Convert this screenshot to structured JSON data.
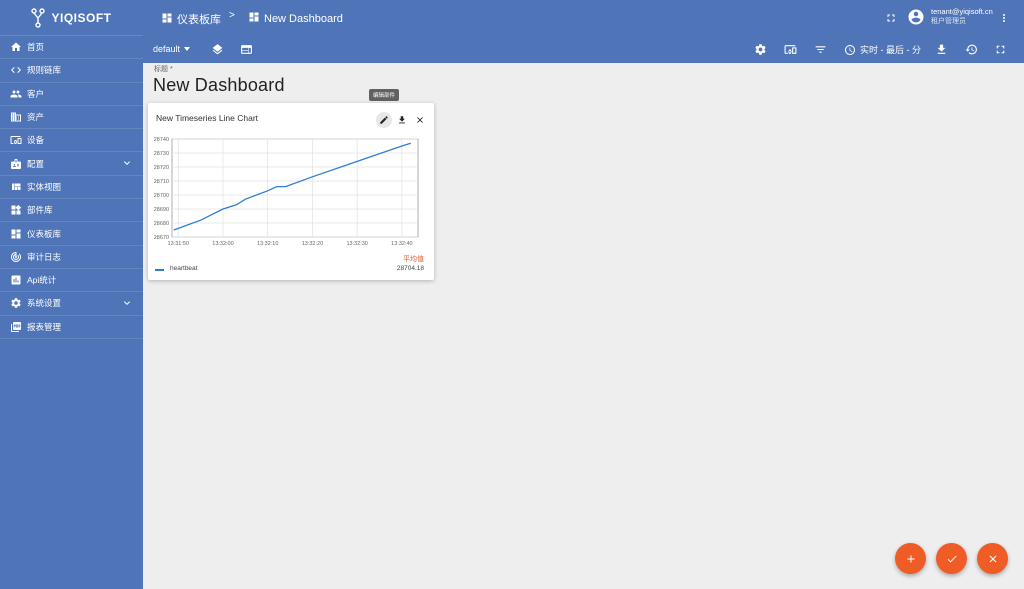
{
  "app": {
    "logo_text": "YIQISOFT"
  },
  "sidebar": {
    "items": [
      {
        "label": "首页",
        "icon": "home-icon"
      },
      {
        "label": "规则链库",
        "icon": "code-icon"
      },
      {
        "label": "客户",
        "icon": "people-icon"
      },
      {
        "label": "资产",
        "icon": "domain-icon"
      },
      {
        "label": "设备",
        "icon": "devices-icon"
      },
      {
        "label": "配置",
        "icon": "badge-icon",
        "expandable": true
      },
      {
        "label": "实体视图",
        "icon": "view-quilt-icon"
      },
      {
        "label": "部件库",
        "icon": "widgets-icon"
      },
      {
        "label": "仪表板库",
        "icon": "dashboard-icon"
      },
      {
        "label": "审计日志",
        "icon": "track-changes-icon"
      },
      {
        "label": "Api统计",
        "icon": "insert-chart-icon"
      },
      {
        "label": "系统设置",
        "icon": "settings-icon",
        "expandable": true
      },
      {
        "label": "报表管理",
        "icon": "pdf-icon"
      }
    ]
  },
  "header": {
    "breadcrumb": [
      {
        "label": "仪表板库",
        "icon": "dashboard-icon"
      },
      {
        "label": "New Dashboard",
        "icon": "dashboard-icon"
      }
    ],
    "separator": ">",
    "user_email": "tenant@yiqisoft.cn",
    "user_role": "租户管理员"
  },
  "toolbar": {
    "state_selector": "default",
    "timewindow": "实时 - 最后 - 分"
  },
  "main": {
    "title_label": "标题 *",
    "title_value": "New Dashboard",
    "tooltip": "编辑部件"
  },
  "widget": {
    "title": "New Timeseries Line Chart",
    "legend_header": "平均值",
    "legend_entry": "heartbeat",
    "legend_avg": "28704.18",
    "series_color": "#2e7cd6"
  },
  "chart_data": {
    "type": "line",
    "title": "",
    "xlabel": "",
    "ylabel": "",
    "ylim": [
      28670,
      28740
    ],
    "y_ticks": [
      28740,
      28730,
      28720,
      28710,
      28700,
      28690,
      28680,
      28670
    ],
    "x_ticks": [
      "13:31:50",
      "13:32:00",
      "13:32:10",
      "13:32:20",
      "13:32:30",
      "13:32:40"
    ],
    "series": [
      {
        "name": "heartbeat",
        "x": [
          "13:31:49",
          "13:31:55",
          "13:32:00",
          "13:32:03",
          "13:32:05",
          "13:32:10",
          "13:32:12",
          "13:32:14",
          "13:32:20",
          "13:32:30",
          "13:32:40",
          "13:32:42"
        ],
        "values": [
          28675,
          28682,
          28690,
          28693,
          28697,
          28703,
          28706,
          28706,
          28713,
          28724,
          28735,
          28737
        ]
      }
    ]
  },
  "colors": {
    "primary": "#4f75b8",
    "accent": "#f05c25",
    "background": "#eeeeee"
  }
}
